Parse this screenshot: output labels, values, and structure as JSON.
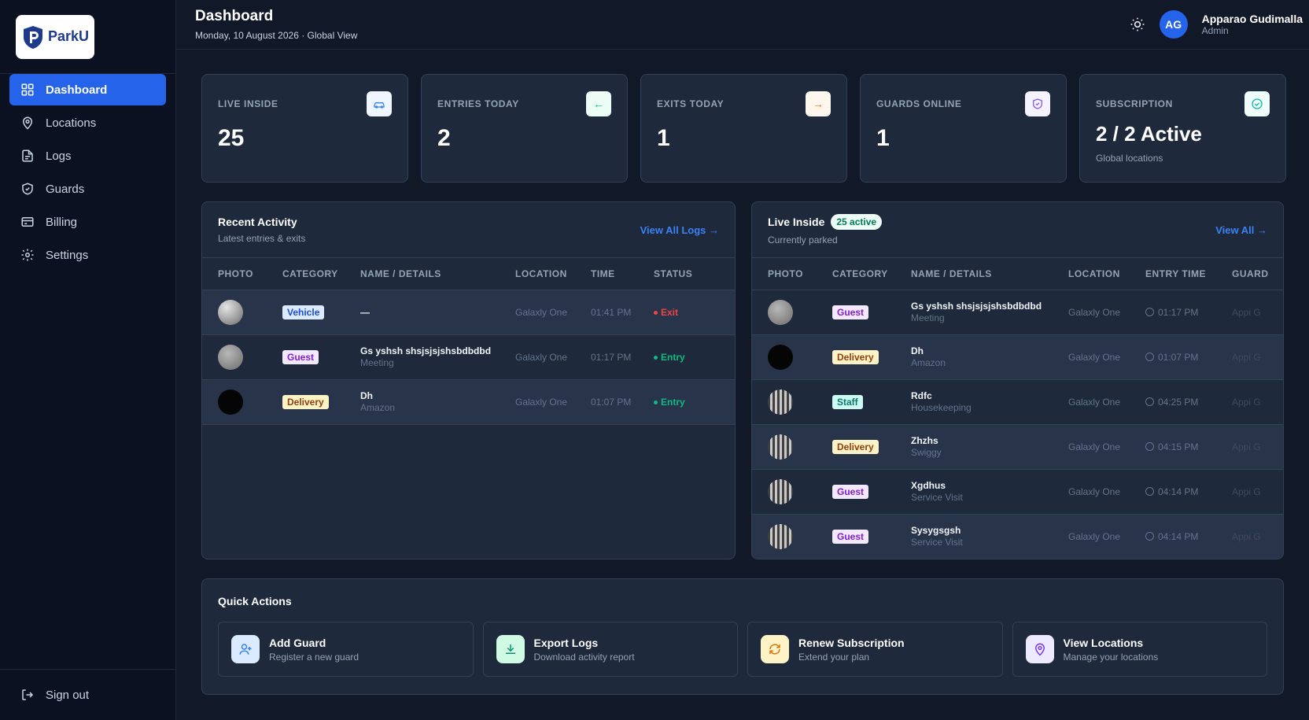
{
  "brand": {
    "name": "ParkU"
  },
  "sidebar": {
    "items": [
      {
        "label": "Dashboard",
        "icon": "grid-icon",
        "active": true
      },
      {
        "label": "Locations",
        "icon": "map-pin-icon"
      },
      {
        "label": "Logs",
        "icon": "file-icon"
      },
      {
        "label": "Guards",
        "icon": "shield-icon"
      },
      {
        "label": "Billing",
        "icon": "card-icon"
      },
      {
        "label": "Settings",
        "icon": "gear-icon"
      }
    ],
    "signout": "Sign out"
  },
  "header": {
    "title": "Dashboard",
    "subtitle": "Monday, 10 August 2026 · Global View",
    "user": {
      "initials": "AG",
      "name": "Apparao Gudimalla",
      "role": "Admin"
    }
  },
  "stats": [
    {
      "label": "LIVE INSIDE",
      "value": "25",
      "icon": "car-icon",
      "iconColor": "#3b82f6"
    },
    {
      "label": "ENTRIES TODAY",
      "value": "2",
      "icon": "arrow-left-icon",
      "iconColor": "#10b981"
    },
    {
      "label": "EXITS TODAY",
      "value": "1",
      "icon": "arrow-right-icon",
      "iconColor": "#f97316"
    },
    {
      "label": "GUARDS ONLINE",
      "value": "1",
      "icon": "shield-icon",
      "iconColor": "#8b5cf6"
    },
    {
      "label": "SUBSCRIPTION",
      "value": "2 / 2 Active",
      "note": "Global locations",
      "icon": "check-circle-icon",
      "iconColor": "#14b8a6"
    }
  ],
  "recent": {
    "title": "Recent Activity",
    "subtitle": "Latest entries & exits",
    "link": "View All Logs →",
    "columns": [
      "PHOTO",
      "CATEGORY",
      "NAME / DETAILS",
      "LOCATION",
      "TIME",
      "STATUS"
    ],
    "rows": [
      {
        "photo": "stone",
        "category": "Vehicle",
        "name": "—",
        "detail": "",
        "location": "Galaxly One",
        "time": "01:41 PM",
        "status": "Exit"
      },
      {
        "photo": "gray",
        "category": "Guest",
        "name": "Gs yshsh shsjsjsjshsbdbdbd",
        "detail": "Meeting",
        "location": "Galaxly One",
        "time": "01:17 PM",
        "status": "Entry"
      },
      {
        "photo": "black",
        "category": "Delivery",
        "name": "Dh",
        "detail": "Amazon",
        "location": "Galaxly One",
        "time": "01:07 PM",
        "status": "Entry"
      }
    ]
  },
  "live": {
    "title": "Live Inside",
    "badge": "25 active",
    "subtitle": "Currently parked",
    "link": "View All →",
    "columns": [
      "PHOTO",
      "CATEGORY",
      "NAME / DETAILS",
      "LOCATION",
      "ENTRY TIME",
      "GUARD"
    ],
    "rows": [
      {
        "photo": "gray",
        "category": "Guest",
        "name": "Gs yshsh shsjsjsjshsbdbdbd",
        "detail": "Meeting",
        "location": "Galaxly One",
        "time": "01:17 PM",
        "guard": "Appi G"
      },
      {
        "photo": "black",
        "category": "Delivery",
        "name": "Dh",
        "detail": "Amazon",
        "location": "Galaxly One",
        "time": "01:07 PM",
        "guard": "Appi G"
      },
      {
        "photo": "pattern",
        "category": "Staff",
        "name": "Rdfc",
        "detail": "Housekeeping",
        "location": "Galaxly One",
        "time": "04:25 PM",
        "guard": "Appi G"
      },
      {
        "photo": "pattern",
        "category": "Delivery",
        "name": "Zhzhs",
        "detail": "Swiggy",
        "location": "Galaxly One",
        "time": "04:15 PM",
        "guard": "Appi G"
      },
      {
        "photo": "pattern",
        "category": "Guest",
        "name": "Xgdhus",
        "detail": "Service Visit",
        "location": "Galaxly One",
        "time": "04:14 PM",
        "guard": "Appi G"
      },
      {
        "photo": "pattern",
        "category": "Guest",
        "name": "Sysygsgsh",
        "detail": "Service Visit",
        "location": "Galaxly One",
        "time": "04:14 PM",
        "guard": "Appi G"
      }
    ]
  },
  "quick": {
    "title": "Quick Actions",
    "actions": [
      {
        "title": "Add Guard",
        "sub": "Register a new guard",
        "icon": "user-plus-icon",
        "color": "#3b82f6",
        "bg": "#dbeafe"
      },
      {
        "title": "Export Logs",
        "sub": "Download activity report",
        "icon": "download-icon",
        "color": "#059669",
        "bg": "#d1fae5"
      },
      {
        "title": "Renew Subscription",
        "sub": "Extend your plan",
        "icon": "refresh-icon",
        "color": "#d97706",
        "bg": "#fef3c7"
      },
      {
        "title": "View Locations",
        "sub": "Manage your locations",
        "icon": "map-pin-icon",
        "color": "#7c3aed",
        "bg": "#ede9fe"
      }
    ]
  }
}
